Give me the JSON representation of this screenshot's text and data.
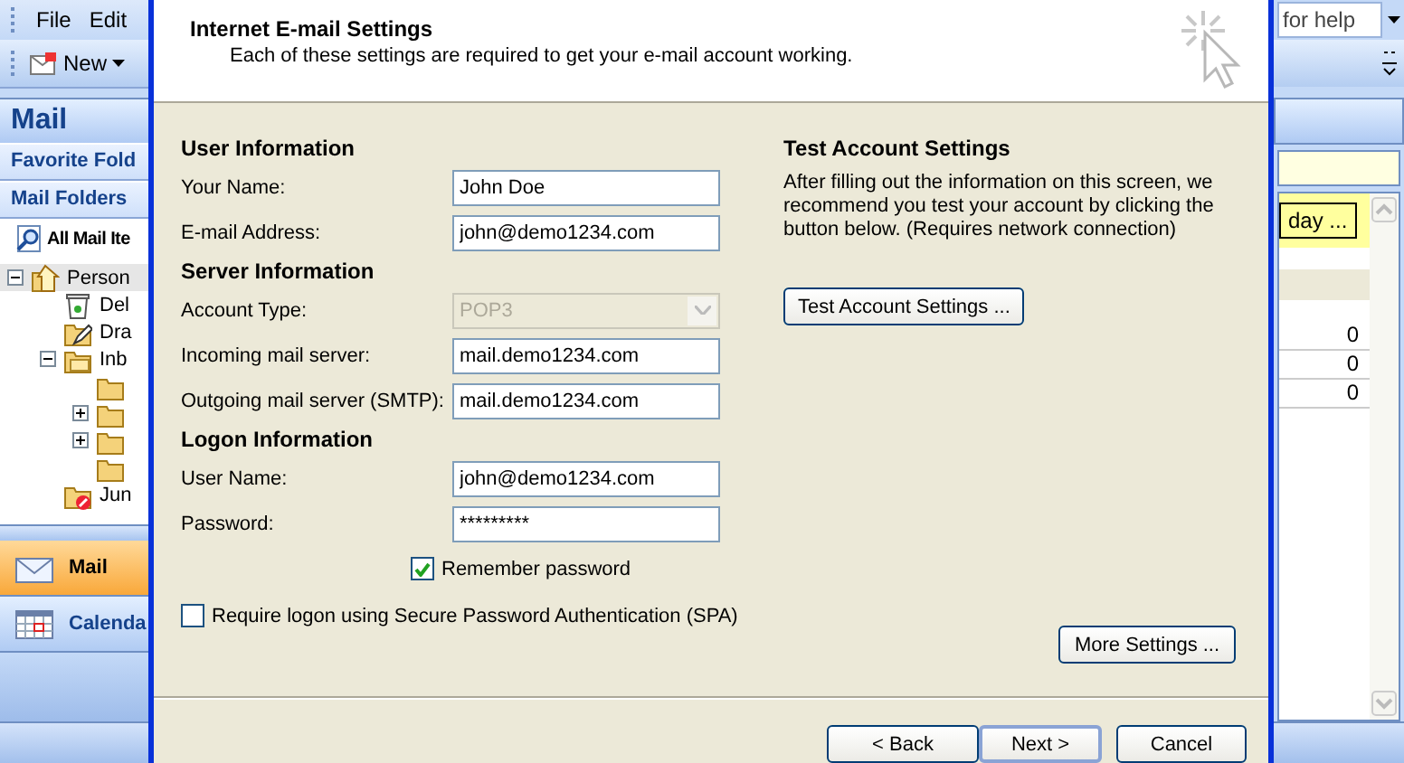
{
  "outlook": {
    "menu": [
      {
        "label": "File"
      },
      {
        "label": "Edit"
      }
    ],
    "toolbar": {
      "new_button": "New"
    },
    "nav_title": "Mail",
    "panes": [
      {
        "label": "Favorite Fold"
      },
      {
        "label": "Mail Folders"
      }
    ],
    "all_mail": "All Mail Ite",
    "tree": [
      {
        "label": "Person",
        "kind": "account",
        "expanded": true,
        "children": [
          {
            "label": "Del",
            "kind": "trash"
          },
          {
            "label": "Dra",
            "kind": "drafts"
          },
          {
            "label": "Inb",
            "kind": "inbox",
            "expanded": true,
            "children": [
              {
                "kind": "folder"
              },
              {
                "kind": "folder",
                "expanded": false
              },
              {
                "kind": "folder",
                "expanded": false
              },
              {
                "kind": "folder"
              }
            ]
          },
          {
            "label": "Jun",
            "kind": "junk"
          }
        ]
      }
    ],
    "nav_buttons": [
      {
        "label": "Mail",
        "kind": "mail",
        "selected": true
      },
      {
        "label": "Calenda",
        "kind": "calendar",
        "selected": false
      }
    ],
    "help_search": {
      "placeholder": "for help"
    },
    "reminder_button": "day ...",
    "counts": [
      "0",
      "0",
      "0"
    ]
  },
  "dialog": {
    "title": "Internet E-mail Settings",
    "subtitle": "Each of these settings are required to get your e-mail account working.",
    "sections": [
      {
        "heading": "User Information",
        "fields": [
          {
            "label": "Your Name:",
            "value": "John Doe",
            "kind": "text"
          },
          {
            "label": "E-mail Address:",
            "value": "john@demo1234.com",
            "kind": "text"
          }
        ]
      },
      {
        "heading": "Server Information",
        "fields": [
          {
            "label": "Account Type:",
            "value": "POP3",
            "kind": "select",
            "disabled": true
          },
          {
            "label": "Incoming mail server:",
            "value": "mail.demo1234.com",
            "kind": "text"
          },
          {
            "label": "Outgoing mail server (SMTP):",
            "value": "mail.demo1234.com",
            "kind": "text"
          }
        ]
      },
      {
        "heading": "Logon Information",
        "fields": [
          {
            "label": "User Name:",
            "value": "john@demo1234.com",
            "kind": "text"
          },
          {
            "label": "Password:",
            "value": "*********",
            "kind": "text"
          }
        ]
      }
    ],
    "remember_password": {
      "label": "Remember password",
      "checked": true
    },
    "spa": {
      "label": "Require logon using Secure Password Authentication (SPA)",
      "checked": false
    },
    "test": {
      "heading": "Test Account Settings",
      "text": "After filling out the information on this screen, we recommend you test your account by clicking the button below. (Requires network connection)",
      "button": "Test Account Settings ..."
    },
    "more_settings": "More Settings ...",
    "buttons": [
      {
        "label": "< Back",
        "default": false
      },
      {
        "label": "Next >",
        "default": true
      },
      {
        "label": "Cancel",
        "default": false
      }
    ]
  }
}
